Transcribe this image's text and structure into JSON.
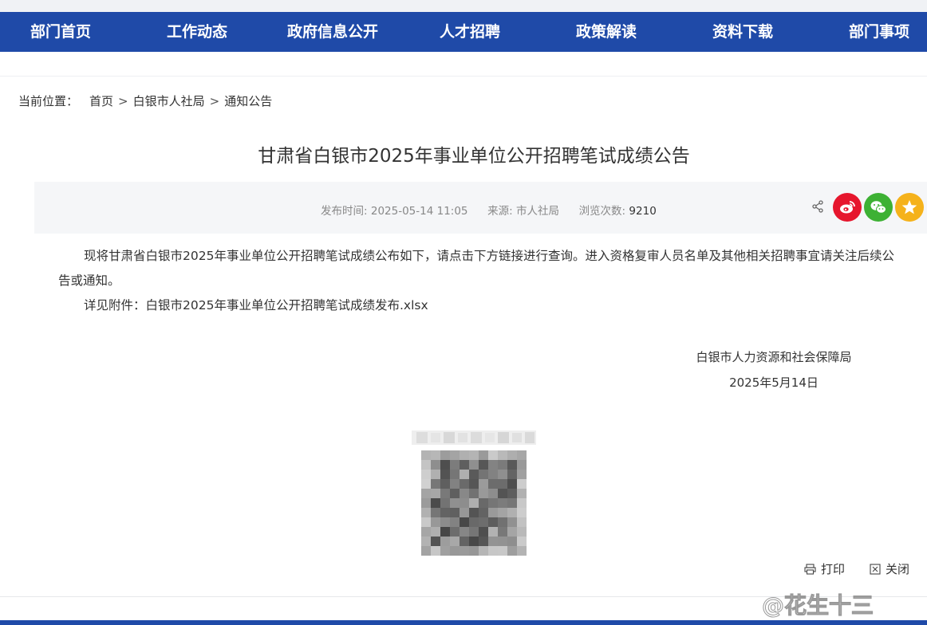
{
  "nav": {
    "items": [
      "部门首页",
      "工作动态",
      "政府信息公开",
      "人才招聘",
      "政策解读",
      "资料下载",
      "部门事项"
    ]
  },
  "breadcrumb": {
    "label": "当前位置：",
    "items": [
      "首页",
      "白银市人社局",
      "通知公告"
    ],
    "separator": ">"
  },
  "article": {
    "title": "甘肃省白银市2025年事业单位公开招聘笔试成绩公告",
    "meta": {
      "publish_label": "发布时间:",
      "publish_time": "2025-05-14 11:05",
      "source_label": "来源:",
      "source": "市人社局",
      "views_label": "浏览次数:",
      "views": "9210"
    },
    "paragraph1": "现将甘肃省白银市2025年事业单位公开招聘笔试成绩公布如下，请点击下方链接进行查询。进入资格复审人员名单及其他相关招聘事宜请关注后续公告或通知。",
    "attachment_label": "详见附件：",
    "attachment_link": "白银市2025年事业单位公开招聘笔试成绩发布.xlsx",
    "signature_org": "白银市人力资源和社会保障局",
    "signature_date": "2025年5月14日"
  },
  "actions": {
    "print": "打印",
    "close": "关闭"
  },
  "watermark": "@花生十三",
  "colors": {
    "nav_bg": "#1f4aa8",
    "weibo": "#e6162d",
    "wechat": "#3db134",
    "favorite": "#f5b21b"
  },
  "icons": [
    "share-icon",
    "weibo-icon",
    "wechat-icon",
    "star-icon",
    "print-icon",
    "close-icon"
  ]
}
